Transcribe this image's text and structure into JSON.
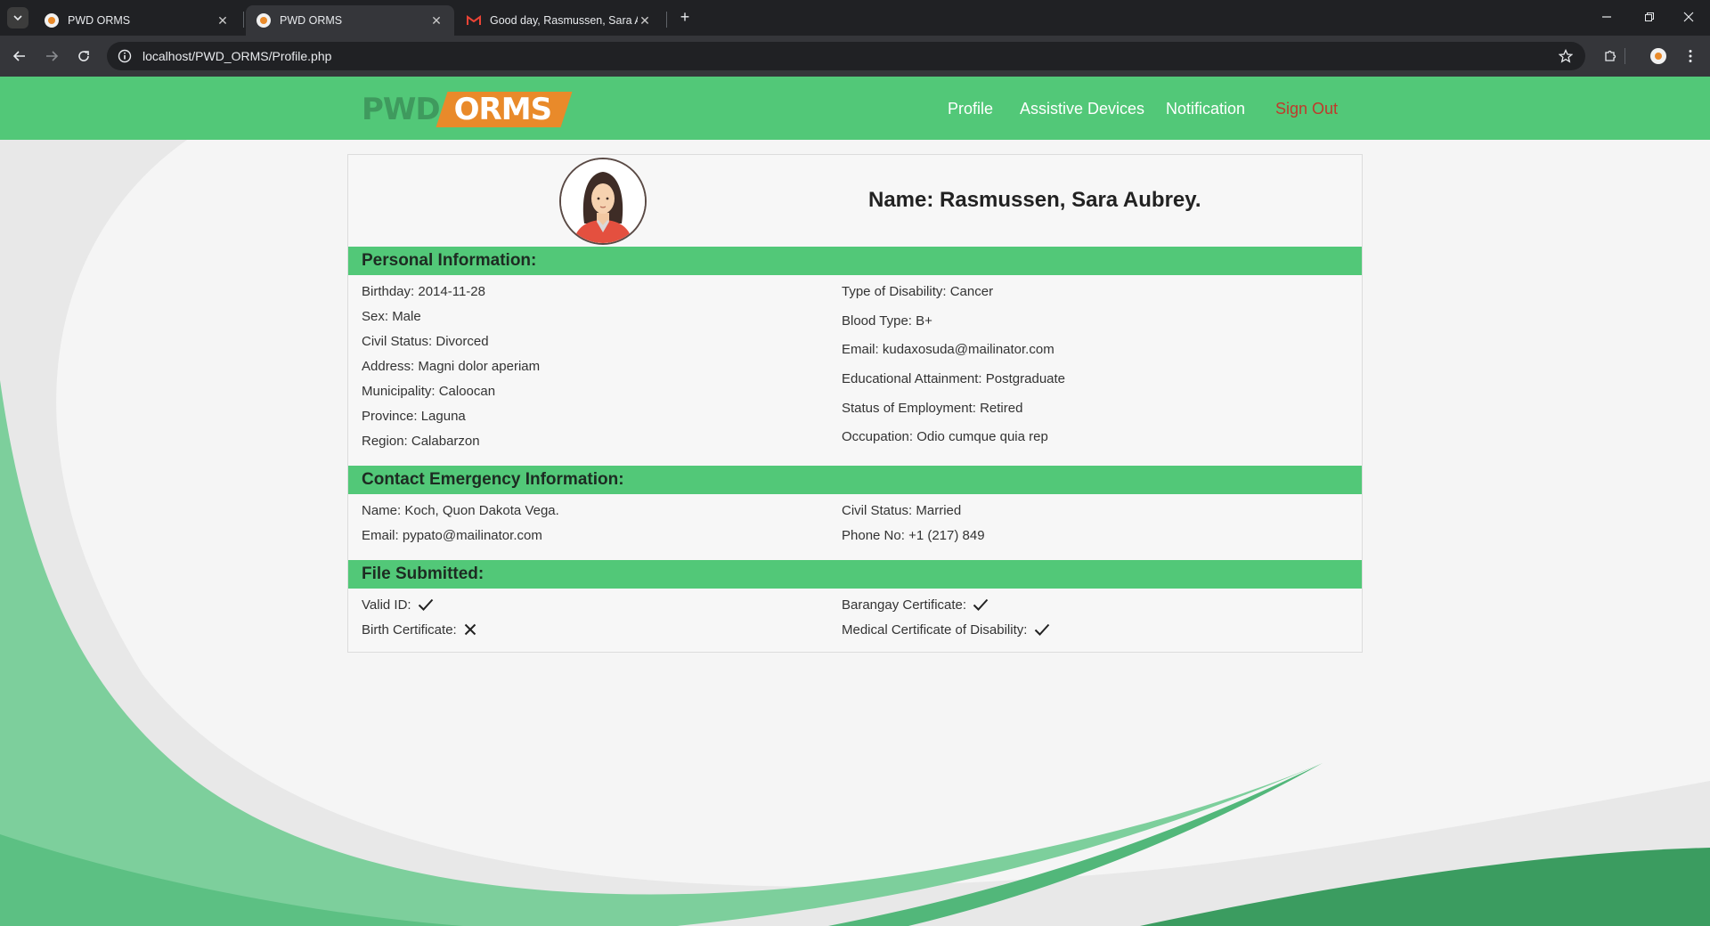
{
  "browser": {
    "tabs": [
      {
        "title": "PWD ORMS",
        "active": false
      },
      {
        "title": "PWD ORMS",
        "active": true
      },
      {
        "title": "Good day, Rasmussen, Sara Aub",
        "active": false
      }
    ],
    "url": "localhost/PWD_ORMS/Profile.php"
  },
  "site": {
    "logo_left": "PWD",
    "logo_right": "ORMS",
    "nav": {
      "profile": "Profile",
      "assistive_devices": "Assistive Devices",
      "notification": "Notification",
      "sign_out": "Sign Out"
    }
  },
  "profile": {
    "name_label": "Name:",
    "name": "Rasmussen, Sara Aubrey."
  },
  "personal": {
    "heading": "Personal Information:",
    "left": [
      {
        "label": "Birthday:",
        "value": "2014-11-28"
      },
      {
        "label": "Sex:",
        "value": "Male"
      },
      {
        "label": "Civil Status:",
        "value": "Divorced"
      },
      {
        "label": "Address:",
        "value": "Magni dolor aperiam"
      },
      {
        "label": "Municipality:",
        "value": "Caloocan"
      },
      {
        "label": "Province:",
        "value": "Laguna"
      },
      {
        "label": "Region:",
        "value": "Calabarzon"
      }
    ],
    "right": [
      {
        "label": "Type of Disability:",
        "value": "Cancer"
      },
      {
        "label": "Blood Type:",
        "value": "B+"
      },
      {
        "label": "Email:",
        "value": "kudaxosuda@mailinator.com"
      },
      {
        "label": "Educational Attainment:",
        "value": "Postgraduate"
      },
      {
        "label": "Status of Employment:",
        "value": "Retired"
      },
      {
        "label": "Occupation:",
        "value": "Odio cumque quia rep"
      }
    ]
  },
  "emergency": {
    "heading": "Contact Emergency Information:",
    "name": {
      "label": "Name:",
      "value": "Koch, Quon Dakota Vega."
    },
    "email": {
      "label": "Email:",
      "value": "pypato@mailinator.com"
    },
    "civil_status": {
      "label": "Civil Status:",
      "value": "Married"
    },
    "phone": {
      "label": "Phone No:",
      "value": "+1 (217) 849"
    }
  },
  "files": {
    "heading": "File Submitted:",
    "valid_id": {
      "label": "Valid ID:",
      "status": "submitted"
    },
    "birth_certificate": {
      "label": "Birth Certificate:",
      "status": "missing"
    },
    "barangay_certificate": {
      "label": "Barangay Certificate:",
      "status": "submitted"
    },
    "medical_certificate": {
      "label": "Medical Certificate of Disability:",
      "status": "submitted"
    }
  },
  "colors": {
    "nav_green": "#52c878",
    "logo_orange": "#e98a2a",
    "sign_out_red": "#c0392b"
  }
}
